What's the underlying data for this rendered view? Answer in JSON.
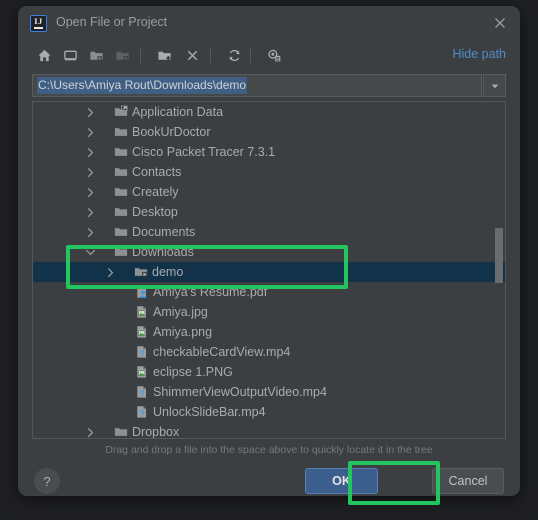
{
  "window": {
    "title": "Open File or Project",
    "app_icon": "intellij-idea-logo",
    "app_icon_text": "IJ",
    "close_icon": "close-icon"
  },
  "toolbar": {
    "buttons": [
      {
        "name": "home",
        "icon": "home-icon",
        "enabled": true
      },
      {
        "name": "desktop",
        "icon": "desktop-icon",
        "enabled": true
      },
      {
        "name": "project-directory",
        "icon": "folder-project-icon",
        "enabled": true
      },
      {
        "name": "module-directory",
        "icon": "folder-module-icon",
        "enabled": false
      },
      {
        "name": "new-folder",
        "icon": "folder-add-icon",
        "enabled": true
      },
      {
        "name": "delete",
        "icon": "close-x-icon",
        "enabled": true
      },
      {
        "name": "refresh",
        "icon": "refresh-icon",
        "enabled": true
      },
      {
        "name": "show-hidden",
        "icon": "show-hidden-files-icon",
        "enabled": true
      }
    ],
    "hide_path_label": "Hide path"
  },
  "path_field": {
    "value": "C:\\Users\\Amiya Rout\\Downloads\\demo",
    "placeholder": "",
    "selected": true,
    "dropdown_icon": "chevron-down-icon"
  },
  "tree": {
    "rows": [
      {
        "label": "Application Data",
        "indent": 1,
        "arrow": "chevron-right",
        "icon": "folder-shortcut-icon",
        "selected": false
      },
      {
        "label": "BookUrDoctor",
        "indent": 1,
        "arrow": "chevron-right",
        "icon": "folder-icon",
        "selected": false
      },
      {
        "label": "Cisco Packet Tracer 7.3.1",
        "indent": 1,
        "arrow": "chevron-right",
        "icon": "folder-icon",
        "selected": false
      },
      {
        "label": "Contacts",
        "indent": 1,
        "arrow": "chevron-right",
        "icon": "folder-icon",
        "selected": false
      },
      {
        "label": "Creately",
        "indent": 1,
        "arrow": "chevron-right",
        "icon": "folder-icon",
        "selected": false
      },
      {
        "label": "Desktop",
        "indent": 1,
        "arrow": "chevron-right",
        "icon": "folder-icon",
        "selected": false
      },
      {
        "label": "Documents",
        "indent": 1,
        "arrow": "chevron-right",
        "icon": "folder-icon",
        "selected": false
      },
      {
        "label": "Downloads",
        "indent": 1,
        "arrow": "chevron-down",
        "icon": "folder-icon",
        "selected": false
      },
      {
        "label": "demo",
        "indent": 2,
        "arrow": "chevron-right",
        "icon": "folder-module-icon",
        "selected": true
      },
      {
        "label": "Amiya's Resume.pdf",
        "indent": 3,
        "arrow": "none",
        "icon": "pdf-file-icon",
        "selected": false
      },
      {
        "label": "Amiya.jpg",
        "indent": 3,
        "arrow": "none",
        "icon": "image-file-icon",
        "selected": false
      },
      {
        "label": "Amiya.png",
        "indent": 3,
        "arrow": "none",
        "icon": "image-file-icon",
        "selected": false
      },
      {
        "label": "checkableCardView.mp4",
        "indent": 3,
        "arrow": "none",
        "icon": "unknown-file-icon",
        "selected": false
      },
      {
        "label": "eclipse 1.PNG",
        "indent": 3,
        "arrow": "none",
        "icon": "image-file-icon",
        "selected": false
      },
      {
        "label": "ShimmerViewOutputVideo.mp4",
        "indent": 3,
        "arrow": "none",
        "icon": "unknown-file-icon",
        "selected": false
      },
      {
        "label": "UnlockSlideBar.mp4",
        "indent": 3,
        "arrow": "none",
        "icon": "unknown-file-icon",
        "selected": false
      },
      {
        "label": "Dropbox",
        "indent": 1,
        "arrow": "chevron-right",
        "icon": "folder-icon",
        "selected": false
      }
    ]
  },
  "hint": "Drag and drop a file into the space above to quickly locate it in the tree",
  "footer": {
    "help_label": "?",
    "ok_label": "OK",
    "cancel_label": "Cancel"
  },
  "annotations": {
    "tree_highlight": "downloads-demo-highlight",
    "ok_highlight": "ok-button-highlight",
    "color": "#22c55e"
  }
}
